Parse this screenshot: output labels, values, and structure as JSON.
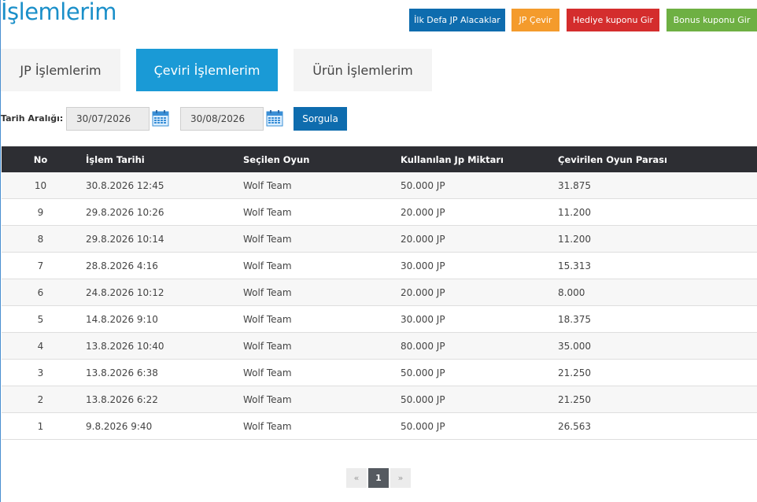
{
  "page": {
    "title": "İşlemlerim"
  },
  "actions": [
    {
      "label": "İlk Defa JP Alacaklar",
      "color": "#0e6cae"
    },
    {
      "label": "JP Çevir",
      "color": "#f49b2c"
    },
    {
      "label": "Hediye kuponu Gir",
      "color": "#d42d2d"
    },
    {
      "label": "Bonus kuponu Gir",
      "color": "#6eb043"
    }
  ],
  "tabs": [
    {
      "label": "JP İşlemlerim",
      "active": false
    },
    {
      "label": "Çeviri İşlemlerim",
      "active": true
    },
    {
      "label": "Ürün İşlemlerim",
      "active": false
    }
  ],
  "filter": {
    "label": "Tarih Aralığı:",
    "start_date": "30/07/2026",
    "end_date": "30/08/2026",
    "submit_label": "Sorgula"
  },
  "table": {
    "headers": [
      "No",
      "İşlem Tarihi",
      "Seçilen Oyun",
      "Kullanılan Jp Miktarı",
      "Çevirilen Oyun Parası"
    ],
    "rows": [
      [
        "10",
        "30.8.2026 12:45",
        "Wolf Team",
        "50.000 JP",
        "31.875"
      ],
      [
        "9",
        "29.8.2026 10:26",
        "Wolf Team",
        "20.000 JP",
        "11.200"
      ],
      [
        "8",
        "29.8.2026 10:14",
        "Wolf Team",
        "20.000 JP",
        "11.200"
      ],
      [
        "7",
        "28.8.2026 4:16",
        "Wolf Team",
        "30.000 JP",
        "15.313"
      ],
      [
        "6",
        "24.8.2026 10:12",
        "Wolf Team",
        "20.000 JP",
        "8.000"
      ],
      [
        "5",
        "14.8.2026 9:10",
        "Wolf Team",
        "30.000 JP",
        "18.375"
      ],
      [
        "4",
        "13.8.2026 10:40",
        "Wolf Team",
        "80.000 JP",
        "35.000"
      ],
      [
        "3",
        "13.8.2026 6:38",
        "Wolf Team",
        "50.000 JP",
        "21.250"
      ],
      [
        "2",
        "13.8.2026 6:22",
        "Wolf Team",
        "50.000 JP",
        "21.250"
      ],
      [
        "1",
        "9.8.2026 9:40",
        "Wolf Team",
        "50.000 JP",
        "26.563"
      ]
    ]
  },
  "pagination": {
    "prev": "«",
    "current": "1",
    "next": "»"
  }
}
